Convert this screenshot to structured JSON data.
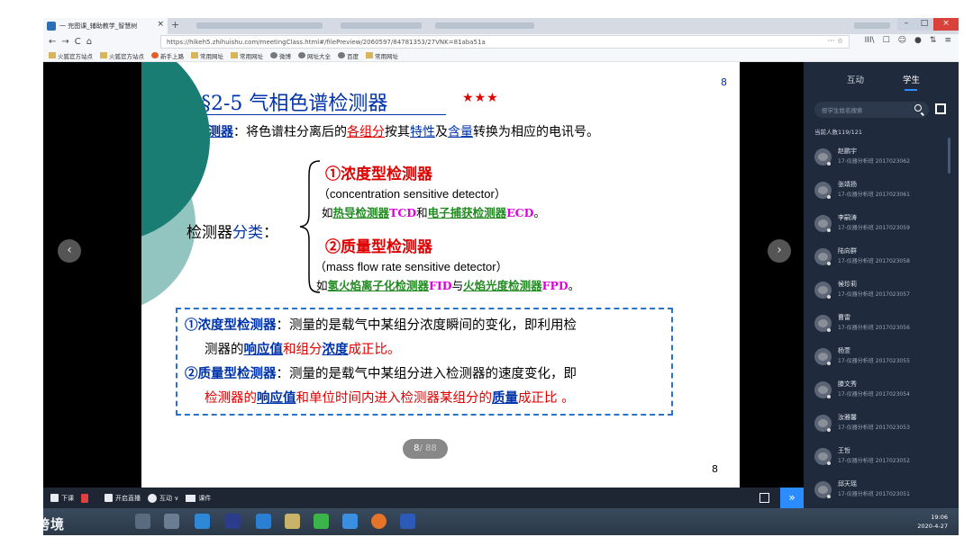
{
  "browser": {
    "tab_title": "一 完图课_辅助教学_智慧树",
    "tab_close": "×",
    "new_tab": "+",
    "url": "https://hikeh5.zhihuishu.com/meetingClass.html#/filePreview/2060597/84781353/27VNK=81aba51a",
    "url_actions": "··· ☆",
    "nav_back": "←",
    "nav_forward": "→",
    "nav_reload": "C",
    "nav_home": "⌂",
    "right_icons": [
      "III\\",
      "☐",
      "☺",
      "●",
      "⇅",
      "≡"
    ],
    "window_min": "–",
    "window_max": "□",
    "window_close": "×",
    "bookmarks": [
      "火狐官方站点",
      "火狐官方站点",
      "新手上路",
      "常用网址",
      "常用网址",
      "微博",
      "网址大全",
      "百度",
      "常用网址"
    ]
  },
  "slide": {
    "page_top": "8",
    "title": "§2-5  气相色谱检测器",
    "stars": "★★★",
    "definition": {
      "term": "检测器",
      "p1": "：将色谱柱分离后的",
      "components": "各组分",
      "p2": "按其",
      "property": "特性",
      "p3": "及",
      "content": "含量",
      "p4": "转换为相应的电讯号。"
    },
    "classification": {
      "label": "检测器",
      "label_blue": "分类",
      "colon": "："
    },
    "type1": {
      "title": "①浓度型检测器",
      "english": "（concentration sensitive detector）",
      "ex_prefix": "如",
      "ex1": "热导检测器",
      "ex1_abbr": "TCD",
      "ex_and": "和",
      "ex2": "电子捕获检测器",
      "ex2_abbr": "ECD",
      "ex_end": "。"
    },
    "type2": {
      "title": "②质量型检测器",
      "english": "（mass flow rate sensitive detector）",
      "ex_prefix": "如",
      "ex1": "氢火焰离子化检测器",
      "ex1_abbr": "FID",
      "ex_and": "与",
      "ex2": "火焰光度检测器",
      "ex2_abbr": "FPD",
      "ex_end": "。"
    },
    "box": {
      "l1_term": "①浓度型检测器",
      "l1_text": "：测量的是载气中某组分浓度瞬间的变化，即利用检",
      "l2_a": "测器的",
      "l2_b": "响应值",
      "l2_c": "和组分",
      "l2_d": "浓度",
      "l2_e": "成正比。",
      "l3_term": "②质量型检测器",
      "l3_text": "：测量的是载气中某组分进入检测器的速度变化，即",
      "l4_a": "检测器的",
      "l4_b": "响应值",
      "l4_c": "和单位时间内进入检测器某组分的",
      "l4_d": "质量",
      "l4_e": "成正比 。"
    },
    "page_current": "8",
    "page_total": "/ 88",
    "page_bottom": "8",
    "prev": "‹",
    "next": "›"
  },
  "panel": {
    "tab_interact": "互动",
    "tab_students": "学生",
    "search_placeholder": "按学生姓名搜索",
    "online_count": "当前人数119/121",
    "students": [
      {
        "name": "赵鹏宇",
        "info": "17-仪器分析班 2017023062"
      },
      {
        "name": "张靖扬",
        "info": "17-仪器分析班 2017023061"
      },
      {
        "name": "李嗣涛",
        "info": "17-仪器分析班 2017023059"
      },
      {
        "name": "陆向群",
        "info": "17-仪器分析班 2017023058"
      },
      {
        "name": "候珍莉",
        "info": "17-仪器分析班 2017023057"
      },
      {
        "name": "曹雷",
        "info": "17-仪器分析班 2017023056"
      },
      {
        "name": "杨萱",
        "info": "17-仪器分析班 2017023055"
      },
      {
        "name": "滕文秀",
        "info": "17-仪器分析班 2017023054"
      },
      {
        "name": "汝雅馨",
        "info": "17-仪器分析班 2017023053"
      },
      {
        "name": "王哲",
        "info": "17-仪器分析班 2017023052"
      },
      {
        "name": "邱天瑶",
        "info": "17-仪器分析班 2017023051"
      }
    ]
  },
  "controls": {
    "leave": "下课",
    "live": "开启直播",
    "interact": "互动 ∨",
    "courseware": "课件",
    "collapse": "»"
  },
  "taskbar": {
    "time": "19:06",
    "date": "2020-4-27"
  },
  "watermark": "大数跨境"
}
